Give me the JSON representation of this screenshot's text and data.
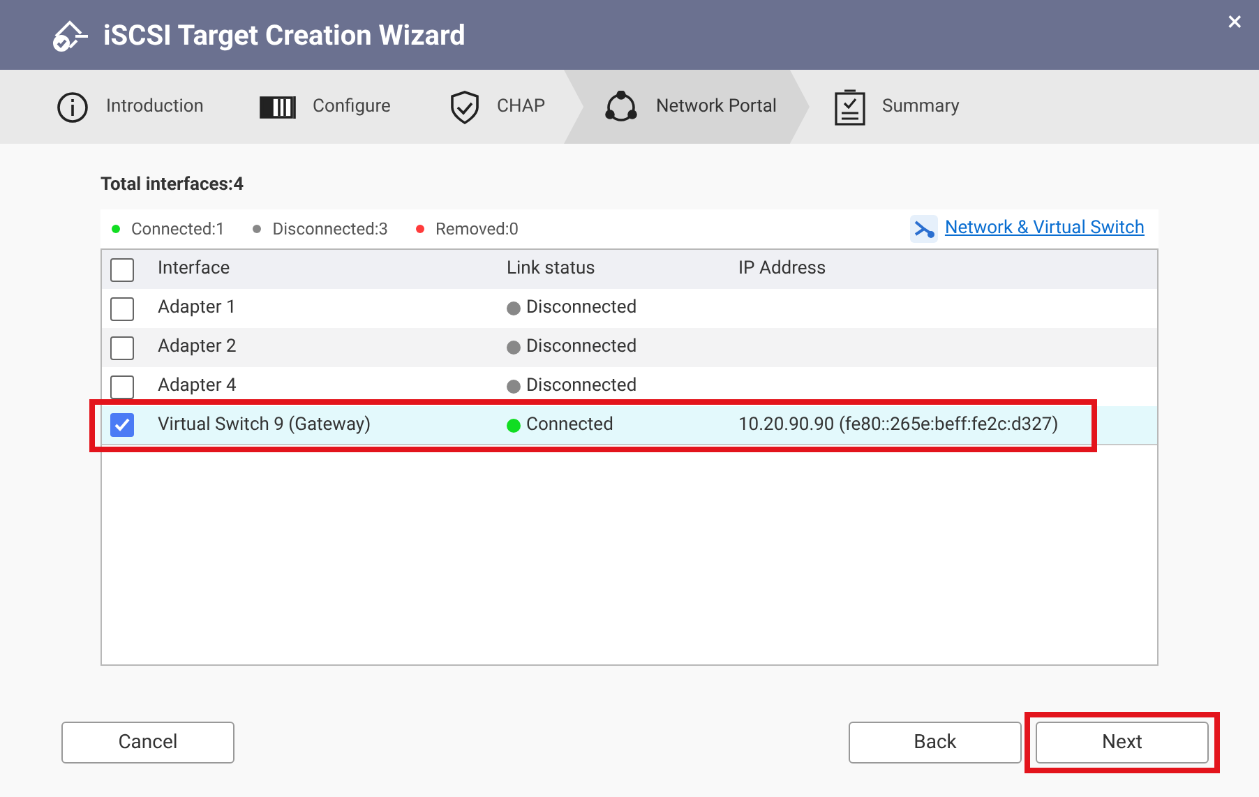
{
  "window": {
    "title": "iSCSI Target Creation Wizard",
    "close": "×"
  },
  "steps": [
    {
      "label": "Introduction",
      "selected": false
    },
    {
      "label": "Configure",
      "selected": false
    },
    {
      "label": "CHAP",
      "selected": false
    },
    {
      "label": "Network Portal",
      "selected": true
    },
    {
      "label": "Summary",
      "selected": false
    }
  ],
  "total": "Total interfaces:4",
  "legend": [
    {
      "label": "Connected:1",
      "color": "#11dd22"
    },
    {
      "label": "Disconnected:3",
      "color": "#888888"
    },
    {
      "label": "Removed:0",
      "color": "#ff3b3b"
    }
  ],
  "link": "Network & Virtual Switch",
  "table": {
    "columns": [
      "Interface",
      "Link status",
      "IP Address"
    ],
    "header_checked": false,
    "rows": [
      {
        "interface": "Adapter 1",
        "status": "Disconnected",
        "color": "#888888",
        "ip": "",
        "checked": false,
        "highlighted": false
      },
      {
        "interface": "Adapter 2",
        "status": "Disconnected",
        "color": "#888888",
        "ip": "",
        "checked": false,
        "highlighted": false
      },
      {
        "interface": "Adapter 4",
        "status": "Disconnected",
        "color": "#888888",
        "ip": "",
        "checked": false,
        "highlighted": false
      },
      {
        "interface": "Virtual Switch 9 (Gateway)",
        "status": "Connected",
        "color": "#11dd22",
        "ip": "10.20.90.90 (fe80::265e:beff:fe2c:d327)",
        "checked": true,
        "highlighted": true
      }
    ]
  },
  "buttons": [
    {
      "label": "Cancel",
      "highlighted": false
    },
    {
      "label": "Back",
      "highlighted": false
    },
    {
      "label": "Next",
      "highlighted": true
    }
  ]
}
